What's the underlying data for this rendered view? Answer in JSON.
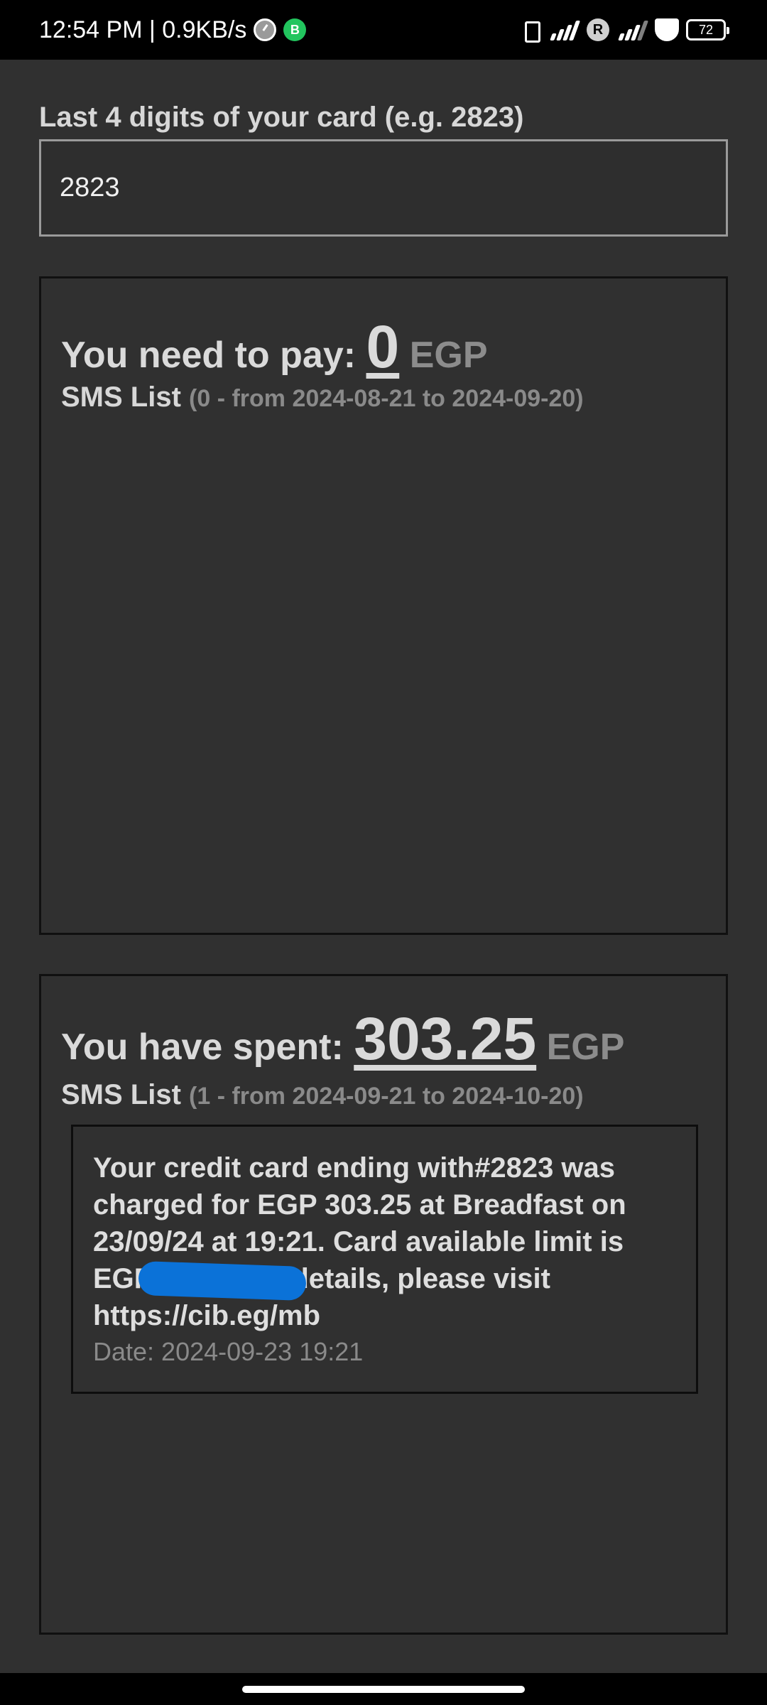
{
  "status_bar": {
    "time_speed": "12:54 PM | 0.9KB/s",
    "b_icon_letter": "B",
    "r_icon_letter": "R",
    "battery": "72"
  },
  "card_input": {
    "label": "Last 4 digits of your card (e.g. 2823)",
    "value": "2823"
  },
  "pay_panel": {
    "heading_prefix": "You need to pay:",
    "amount": "0",
    "currency": "EGP",
    "sms_list_label": "SMS List",
    "sms_list_range": "(0 - from 2024-08-21 to 2024-09-20)"
  },
  "spent_panel": {
    "heading_prefix": "You have spent:",
    "amount": "303.25",
    "currency": "EGP",
    "sms_list_label": "SMS List",
    "sms_list_range": "(1 - from 2024-09-21 to 2024-10-20)",
    "messages": [
      {
        "text": "Your credit card ending with#2823 was charged for EGP 303.25 at Breadfast on 23/09/24  at 19:21. Card available limit is EGP                   For more details, please visit https://cib.eg/mb",
        "date": "Date: 2024-09-23 19:21"
      }
    ]
  }
}
